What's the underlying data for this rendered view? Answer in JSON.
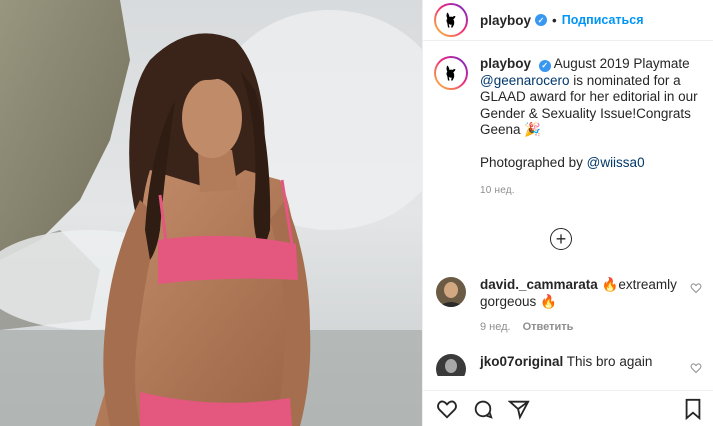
{
  "post": {
    "author": "playboy",
    "follow_label": "Подписаться",
    "separator": "•"
  },
  "caption": {
    "author": "playboy",
    "text_before": "August 2019 Playmate",
    "mention": "@geenarocero",
    "text_after": "is nominated for a GLAAD award for her editorial in our Gender & Sexuality Issue!Congrats Geena 🎉",
    "photographed_label": "Photographed by",
    "photographer": "@wiissa0",
    "time": "10 нед."
  },
  "comments": [
    {
      "user": "david._cammarata",
      "text": "🔥extreamly gorgeous 🔥",
      "time": "9 нед.",
      "reply_label": "Ответить"
    },
    {
      "user": "jko07original",
      "text": "This bro again"
    }
  ],
  "icons": {
    "like": "heart-icon",
    "comment": "comment-icon",
    "share": "share-icon",
    "save": "bookmark-icon",
    "load_more": "plus-circle-icon"
  },
  "colors": {
    "accent": "#0095f6",
    "verified": "#3897f0",
    "muted": "#8e8e8e",
    "bikini": "#e4577f"
  }
}
